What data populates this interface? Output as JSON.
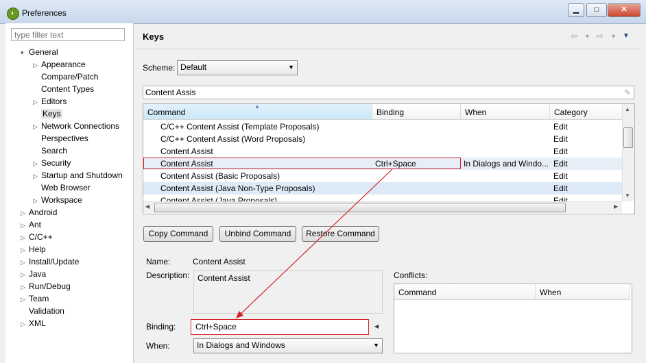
{
  "window": {
    "title": "Preferences",
    "icon": "eclipse-icon"
  },
  "filter": {
    "placeholder": "type filter text"
  },
  "tree": [
    {
      "label": "General",
      "arrow": "▾"
    },
    {
      "label": "Appearance",
      "arrow": "▷"
    },
    {
      "label": "Compare/Patch",
      "arrow": ""
    },
    {
      "label": "Content Types",
      "arrow": ""
    },
    {
      "label": "Editors",
      "arrow": "▷"
    },
    {
      "label": "Keys",
      "arrow": ""
    },
    {
      "label": "Network Connections",
      "arrow": "▷"
    },
    {
      "label": "Perspectives",
      "arrow": ""
    },
    {
      "label": "Search",
      "arrow": ""
    },
    {
      "label": "Security",
      "arrow": "▷"
    },
    {
      "label": "Startup and Shutdown",
      "arrow": "▷"
    },
    {
      "label": "Web Browser",
      "arrow": ""
    },
    {
      "label": "Workspace",
      "arrow": "▷"
    },
    {
      "label": "Android",
      "arrow": "▷"
    },
    {
      "label": "Ant",
      "arrow": "▷"
    },
    {
      "label": "C/C++",
      "arrow": "▷"
    },
    {
      "label": "Help",
      "arrow": "▷"
    },
    {
      "label": "Install/Update",
      "arrow": "▷"
    },
    {
      "label": "Java",
      "arrow": "▷"
    },
    {
      "label": "Run/Debug",
      "arrow": "▷"
    },
    {
      "label": "Team",
      "arrow": "▷"
    },
    {
      "label": "Validation",
      "arrow": ""
    },
    {
      "label": "XML",
      "arrow": "▷"
    }
  ],
  "page": {
    "title": "Keys"
  },
  "scheme": {
    "label": "Scheme:",
    "value": "Default"
  },
  "search": {
    "value": "Content Assis"
  },
  "table": {
    "columns": [
      "Command",
      "Binding",
      "When",
      "Category"
    ],
    "rows": [
      {
        "command": "C/C++ Content Assist (Template Proposals)",
        "binding": "",
        "when": "",
        "category": "Edit"
      },
      {
        "command": "C/C++ Content Assist (Word Proposals)",
        "binding": "",
        "when": "",
        "category": "Edit"
      },
      {
        "command": "Content Assist",
        "binding": "",
        "when": "",
        "category": "Edit"
      },
      {
        "command": "Content Assist",
        "binding": "Ctrl+Space",
        "when": "In Dialogs and Windo...",
        "category": "Edit"
      },
      {
        "command": "Content Assist (Basic Proposals)",
        "binding": "",
        "when": "",
        "category": "Edit"
      },
      {
        "command": "Content Assist (Java Non-Type Proposals)",
        "binding": "",
        "when": "",
        "category": "Edit"
      },
      {
        "command": "Content Assist (Java Proposals)",
        "binding": "",
        "when": "",
        "category": "Edit"
      }
    ]
  },
  "buttons": {
    "copy": "Copy Command",
    "unbind": "Unbind Command",
    "restore": "Restore Command"
  },
  "details": {
    "name_label": "Name:",
    "name_value": "Content Assist",
    "description_label": "Description:",
    "description_value": "Content Assist",
    "binding_label": "Binding:",
    "binding_value": "Ctrl+Space",
    "when_label": "When:",
    "when_value": "In Dialogs and Windows"
  },
  "conflicts": {
    "label": "Conflicts:",
    "columns": [
      "Command",
      "When"
    ]
  },
  "colors": {
    "highlight": "#d2232a",
    "selected_row": "#e8eef7",
    "alt_row": "#ddeaf7"
  }
}
